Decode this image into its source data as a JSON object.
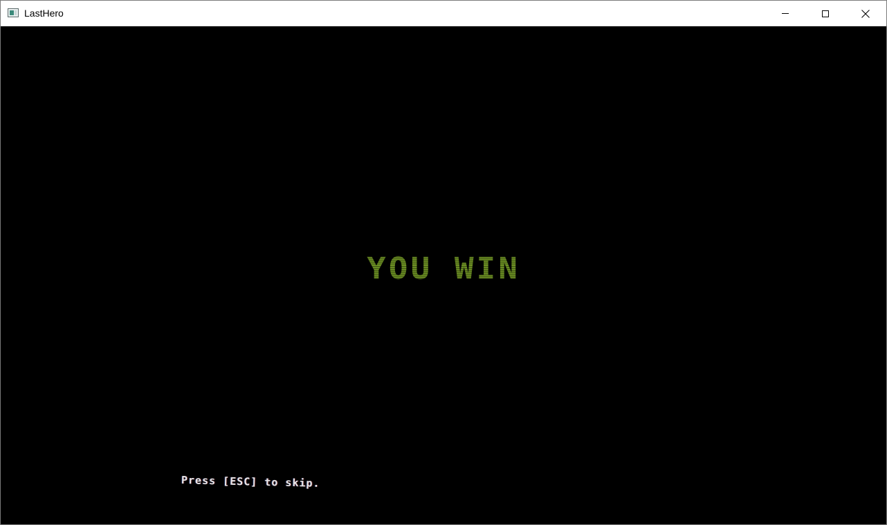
{
  "window": {
    "title": "LastHero",
    "icon": "app-window-icon",
    "controls": {
      "minimize_icon": "minimize-icon",
      "maximize_icon": "maximize-icon",
      "close_icon": "close-icon",
      "close_glyph": "✕"
    }
  },
  "game": {
    "background_color": "#000000",
    "win_message": "YOU WIN",
    "win_color": "#6b8e23",
    "skip_prompt": "Press [ESC] to skip.",
    "skip_color": "#e8e8e8"
  }
}
